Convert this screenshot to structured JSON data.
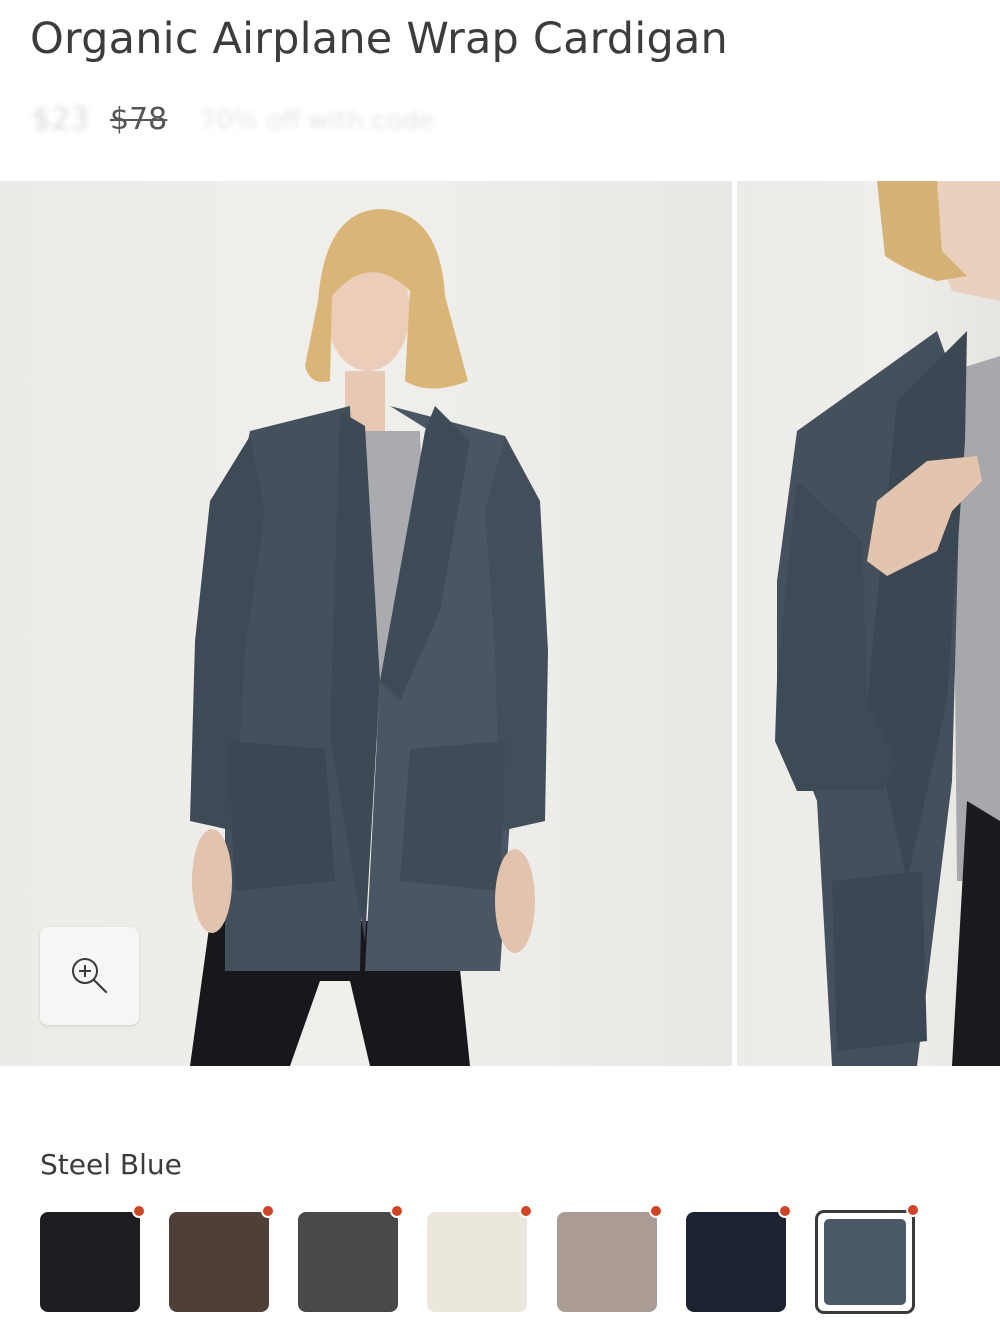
{
  "product": {
    "title": "Organic Airplane Wrap Cardigan",
    "price_sale": "$23",
    "price_original": "$78",
    "discount_note": "70% off with code"
  },
  "gallery": {
    "slides": [
      "model-front-view",
      "model-detail-view"
    ],
    "zoom_icon": "zoom-in-icon"
  },
  "colors": {
    "selected_name": "Steel Blue",
    "swatches": [
      {
        "name": "black",
        "hex": "#1d1e22"
      },
      {
        "name": "brown",
        "hex": "#4e4039"
      },
      {
        "name": "charcoal",
        "hex": "#48494b"
      },
      {
        "name": "cream",
        "hex": "#ece7dc"
      },
      {
        "name": "taupe",
        "hex": "#aa9c95"
      },
      {
        "name": "navy",
        "hex": "#1c2230"
      },
      {
        "name": "steel-blue",
        "hex": "#4a5867"
      }
    ],
    "indicator_color": "#cf4528"
  }
}
